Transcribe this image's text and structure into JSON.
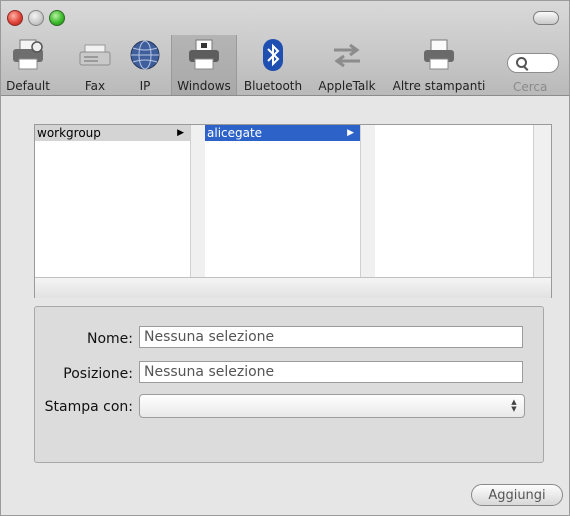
{
  "toolbar": {
    "items": [
      {
        "label": "Default",
        "icon": "printer-default-icon"
      },
      {
        "label": "Fax",
        "icon": "fax-icon"
      },
      {
        "label": "IP",
        "icon": "globe-icon"
      },
      {
        "label": "Windows",
        "icon": "windows-printer-icon",
        "selected": true
      },
      {
        "label": "Bluetooth",
        "icon": "bluetooth-icon"
      },
      {
        "label": "AppleTalk",
        "icon": "appletalk-arrows-icon"
      },
      {
        "label": "Altre stampanti",
        "icon": "printer-icon"
      }
    ],
    "search_label": "Cerca"
  },
  "browser": {
    "column1": [
      {
        "label": "workgroup",
        "arrow": "▶"
      }
    ],
    "column2": [
      {
        "label": "alicegate",
        "arrow": "▶"
      }
    ]
  },
  "form": {
    "name_label": "Nome:",
    "name_value": "Nessuna selezione",
    "location_label": "Posizione:",
    "location_value": "Nessuna selezione",
    "print_with_label": "Stampa con:",
    "print_with_value": ""
  },
  "add_button": "Aggiungi",
  "colors": {
    "selection_blue": "#2d63c8",
    "window_bg": "#e6e6e6"
  }
}
